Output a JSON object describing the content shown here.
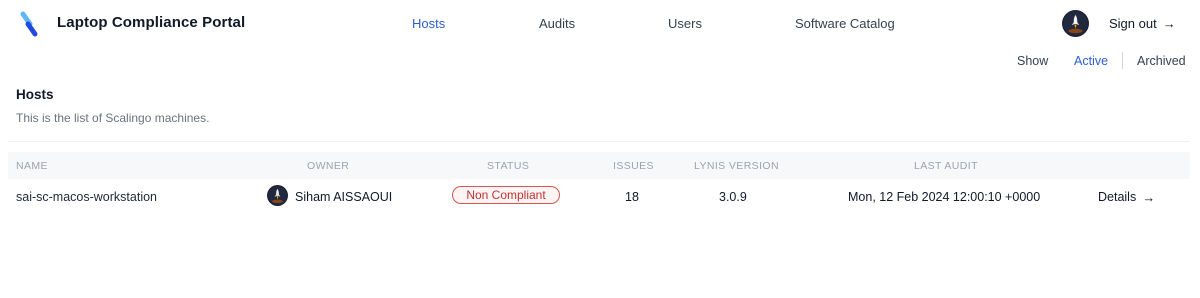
{
  "header": {
    "app_title": "Laptop Compliance Portal",
    "nav": [
      {
        "label": "Hosts",
        "active": true
      },
      {
        "label": "Audits",
        "active": false
      },
      {
        "label": "Users",
        "active": false
      },
      {
        "label": "Software Catalog",
        "active": false
      }
    ],
    "sign_out_label": "Sign out",
    "arrow_glyph": "→"
  },
  "filters": {
    "show_label": "Show",
    "active_label": "Active",
    "archived_label": "Archived",
    "selected": "Active"
  },
  "section": {
    "title": "Hosts",
    "subtitle": "This is the list of Scalingo machines."
  },
  "table": {
    "columns": [
      "Name",
      "Owner",
      "Status",
      "Issues",
      "Lynis Version",
      "Last Audit"
    ],
    "rows": [
      {
        "name": "sai-sc-macos-workstation",
        "owner": "Siham AISSAOUI",
        "status": "Non Compliant",
        "issues": "18",
        "lynis_version": "3.0.9",
        "last_audit": "Mon, 12 Feb 2024 12:00:10 +0000",
        "details_label": "Details"
      }
    ]
  },
  "colors": {
    "accent": "#2b5fd0",
    "logo_light": "#5fb6f0",
    "logo_dark": "#1f49e0",
    "status_noncompliant": "#c53030"
  },
  "icons": {
    "logo": "scalingo-logo-icon",
    "avatar": "rocket-avatar-icon",
    "arrow": "arrow-right-icon"
  }
}
